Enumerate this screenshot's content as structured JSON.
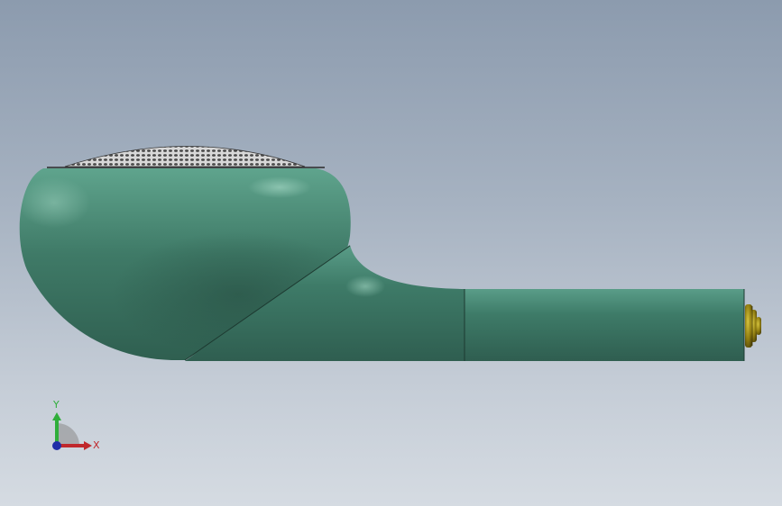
{
  "viewport": {
    "background_top": "#8c9bae",
    "background_bottom": "#d5dbe2"
  },
  "model": {
    "body_color": "#4f8f7b",
    "highlight_color": "#7fbba6",
    "shadow_color": "#2e5b4d",
    "mesh_color": "#5b5b5b",
    "connector_color": "#8c7a12"
  },
  "triad": {
    "x_label": "X",
    "y_label": "Y",
    "x_color": "#c0282c",
    "y_color": "#2fae3a",
    "z_color": "#1f2ea8"
  }
}
